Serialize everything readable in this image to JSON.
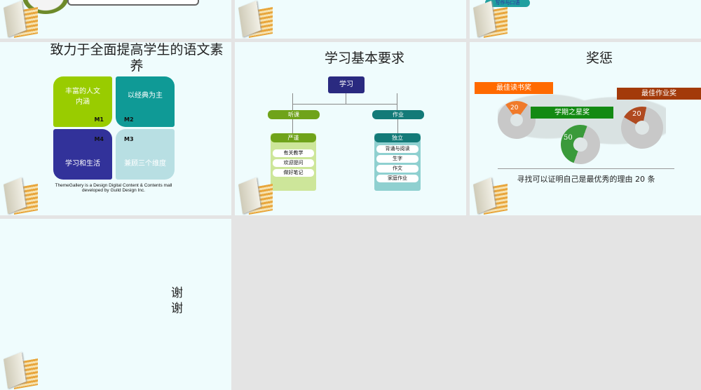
{
  "slide1": {
    "title": "致力于全面提高学生的语文素养",
    "quads": [
      {
        "text": "丰富的人文内涵",
        "tag": "M1"
      },
      {
        "text": "以经典为主",
        "tag": "M2"
      },
      {
        "text": "学习和生活",
        "tag": "M4"
      },
      {
        "text": "兼顾三个维度",
        "tag": "M3"
      }
    ],
    "footer": "ThemeGallery is a Design Digital Content & Contents mall developed by Guild Design Inc."
  },
  "slide2": {
    "title": "学习基本要求",
    "root": "学习",
    "left": {
      "label": "听课",
      "sub": "严谨",
      "items": [
        "有关教学",
        "欢迎提问",
        "做好笔记"
      ]
    },
    "right": {
      "label": "作业",
      "sub": "独立",
      "items": [
        "背诵与阅读",
        "生字",
        "作文",
        "家庭作业"
      ]
    }
  },
  "slide3": {
    "title": "奖惩",
    "awards": [
      {
        "label": "最佳读书奖",
        "value": "20",
        "color": "#ff6a00"
      },
      {
        "label": "学期之星奖",
        "value": "50",
        "color": "#138a13"
      },
      {
        "label": "最佳作业奖",
        "value": "20",
        "color": "#a33a0a"
      }
    ],
    "caption": "寻找可以证明自己是最优秀的理由 20 条"
  },
  "top_partial": {
    "tag": "写作与口语"
  },
  "slide4": {
    "text": "谢谢"
  }
}
